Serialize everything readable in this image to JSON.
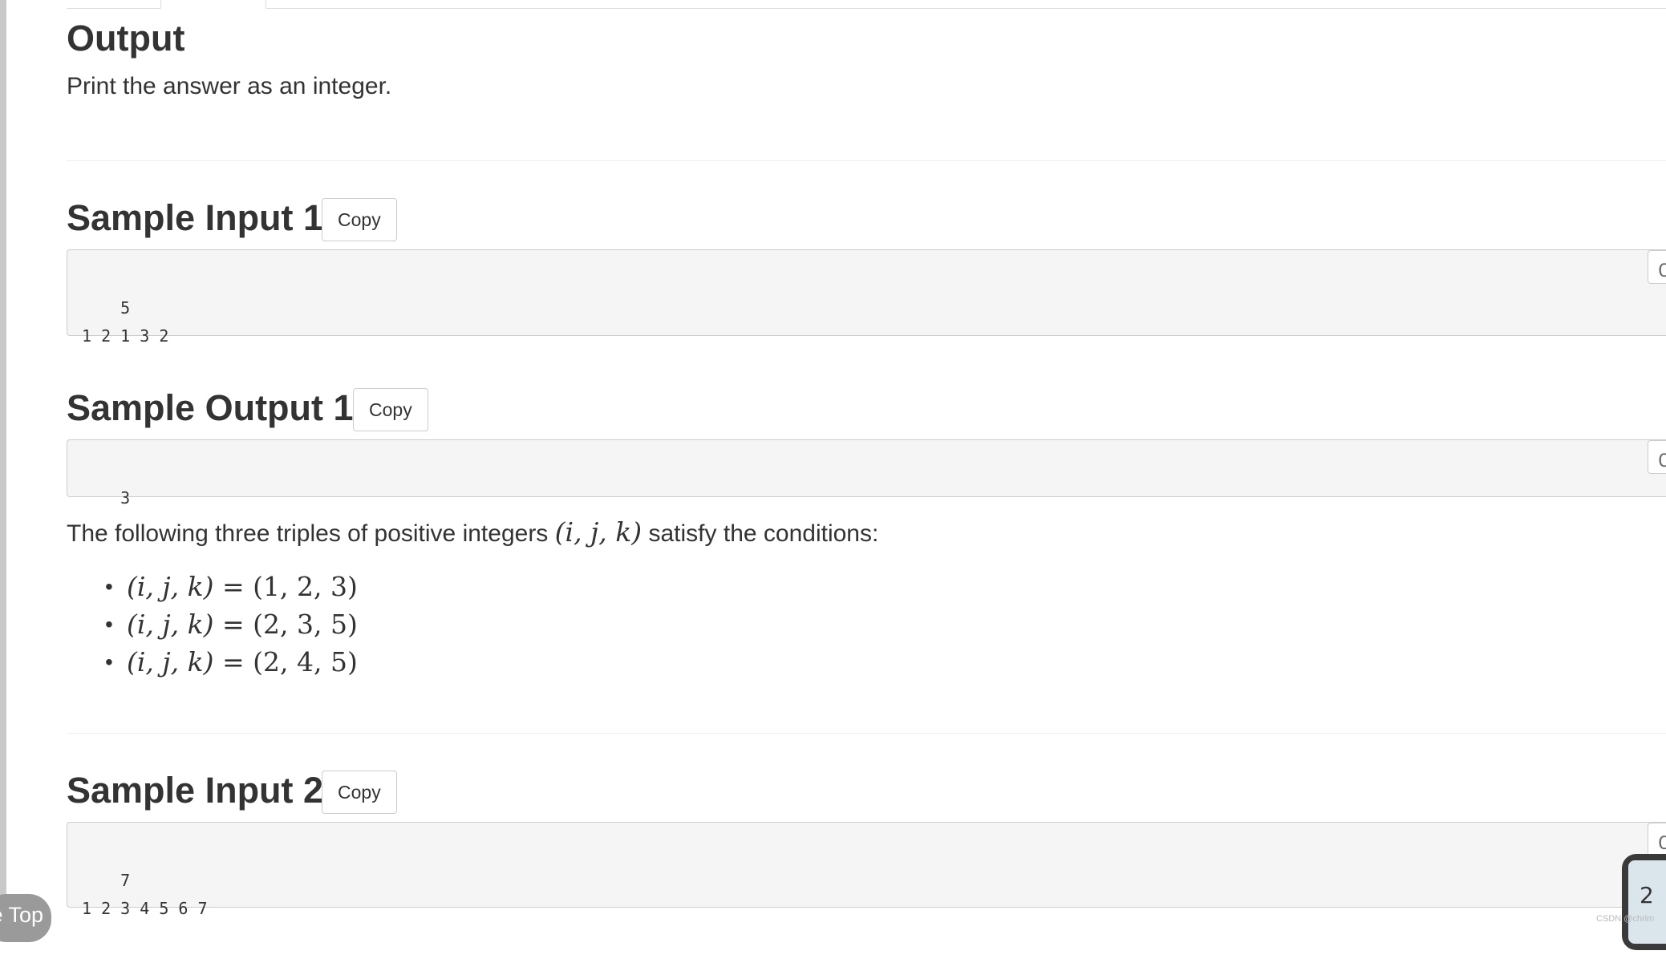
{
  "output_section": {
    "heading": "Output",
    "text": "Print the answer as an integer."
  },
  "sample_input_1": {
    "heading": "Sample Input 1",
    "copy_label": "Copy",
    "content": "5\n1 2 1 3 2",
    "side_copy_label": "C"
  },
  "sample_output_1": {
    "heading": "Sample Output 1",
    "copy_label": "Copy",
    "content": "3",
    "side_copy_label": "C"
  },
  "explanation": {
    "lead_text": "The following three triples of positive integers",
    "lead_math": "(i, j, k)",
    "trail_text": "satisfy the conditions:",
    "triples": [
      {
        "lhs": "(i, j, k)",
        "eq": "=",
        "rhs": "(1, 2, 3)"
      },
      {
        "lhs": "(i, j, k)",
        "eq": "=",
        "rhs": "(2, 3, 5)"
      },
      {
        "lhs": "(i, j, k)",
        "eq": "=",
        "rhs": "(2, 4, 5)"
      }
    ]
  },
  "sample_input_2": {
    "heading": "Sample Input 2",
    "copy_label": "Copy",
    "content": "7\n1 2 3 4 5 6 7",
    "side_copy_label": "C"
  },
  "back_to_top": {
    "label": "e Top"
  },
  "float_widget": {
    "label": "2"
  },
  "watermark": {
    "text": "CSDN @chrim"
  }
}
